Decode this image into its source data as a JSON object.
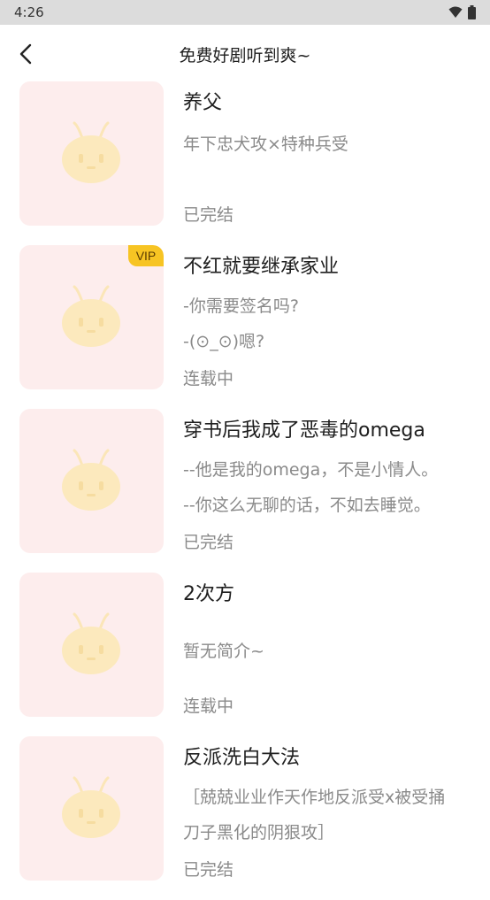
{
  "status_bar": {
    "time": "4:26",
    "icons": [
      "wifi-icon",
      "battery-icon"
    ]
  },
  "header": {
    "title": "免费好剧听到爽~",
    "back_icon": "chevron-left-icon"
  },
  "dramas": [
    {
      "name": "养父",
      "desc": [
        "年下忠犬攻×特种兵受"
      ],
      "status": "已完结",
      "vip": false
    },
    {
      "name": "不红就要继承家业",
      "desc": [
        "-你需要签名吗?",
        "-(⊙_⊙)嗯?"
      ],
      "status": "连载中",
      "vip": true,
      "badge": "VIP"
    },
    {
      "name": "穿书后我成了恶毒的omega",
      "desc": [
        "--他是我的omega，不是小情人。",
        " --你这么无聊的话，不如去睡觉。"
      ],
      "status": "已完结",
      "vip": false
    },
    {
      "name": "2次方",
      "desc": [
        "暂无简介~"
      ],
      "status": "连载中",
      "vip": false
    },
    {
      "name": "反派洗白大法",
      "desc": [
        "［兢兢业业作天作地反派受x被受捅",
        "刀子黑化的阴狠攻］"
      ],
      "status": "已完结",
      "vip": false
    }
  ],
  "colors": {
    "cover_bg": "#fdeded",
    "vip_badge": "#f7c423",
    "status_bar_bg": "#dcdcdc"
  }
}
